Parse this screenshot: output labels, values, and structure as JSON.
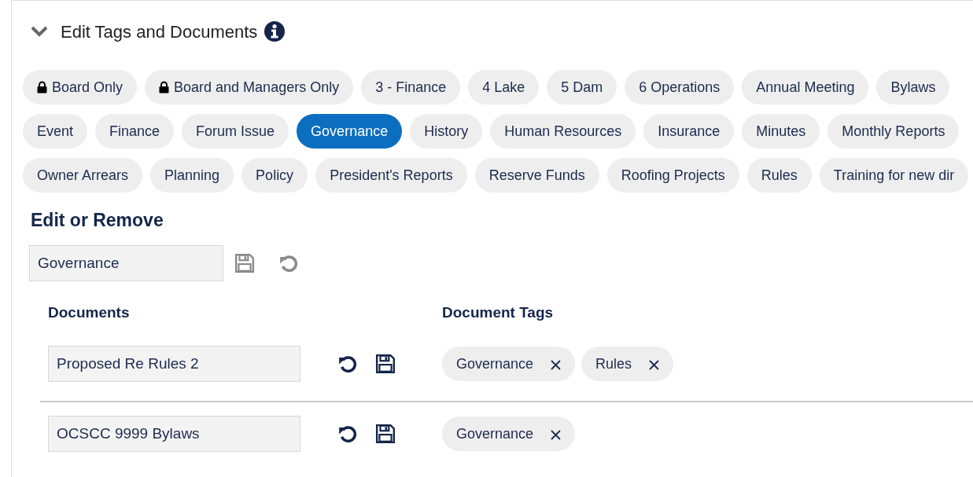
{
  "panel": {
    "title": "Edit Tags and Documents",
    "expanded": true
  },
  "tag_rows": [
    {
      "tags": [
        {
          "label": "Board Only",
          "locked": true,
          "selected": false
        },
        {
          "label": "Board and Managers Only",
          "locked": true,
          "selected": false
        },
        {
          "label": "3 - Finance",
          "locked": false,
          "selected": false
        },
        {
          "label": "4 Lake",
          "locked": false,
          "selected": false
        },
        {
          "label": "5 Dam",
          "locked": false,
          "selected": false
        },
        {
          "label": "6 Operations",
          "locked": false,
          "selected": false
        },
        {
          "label": "Annual Meeting",
          "locked": false,
          "selected": false
        },
        {
          "label": "Bylaws",
          "locked": false,
          "selected": false
        }
      ]
    },
    {
      "tags": [
        {
          "label": "Event",
          "locked": false,
          "selected": false
        },
        {
          "label": "Finance",
          "locked": false,
          "selected": false
        },
        {
          "label": "Forum Issue",
          "locked": false,
          "selected": false
        },
        {
          "label": "Governance",
          "locked": false,
          "selected": true
        },
        {
          "label": "History",
          "locked": false,
          "selected": false
        },
        {
          "label": "Human Resources",
          "locked": false,
          "selected": false
        },
        {
          "label": "Insurance",
          "locked": false,
          "selected": false
        },
        {
          "label": "Minutes",
          "locked": false,
          "selected": false
        },
        {
          "label": "Monthly Reports",
          "locked": false,
          "selected": false
        }
      ]
    },
    {
      "tags": [
        {
          "label": "Owner Arrears",
          "locked": false,
          "selected": false
        },
        {
          "label": "Planning",
          "locked": false,
          "selected": false
        },
        {
          "label": "Policy",
          "locked": false,
          "selected": false
        },
        {
          "label": "President's Reports",
          "locked": false,
          "selected": false
        },
        {
          "label": "Reserve Funds",
          "locked": false,
          "selected": false
        },
        {
          "label": "Roofing Projects",
          "locked": false,
          "selected": false
        },
        {
          "label": "Rules",
          "locked": false,
          "selected": false
        },
        {
          "label": "Training for new dir",
          "locked": false,
          "selected": false
        }
      ]
    }
  ],
  "edit": {
    "heading": "Edit or Remove",
    "value": "Governance",
    "actions_disabled": true
  },
  "documents": {
    "columns": [
      "Documents",
      "Document Tags"
    ],
    "rows": [
      {
        "name": "Proposed Re Rules 2",
        "tags": [
          "Governance",
          "Rules"
        ]
      },
      {
        "name": "OCSCC 9999 Bylaws",
        "tags": [
          "Governance"
        ]
      }
    ]
  }
}
